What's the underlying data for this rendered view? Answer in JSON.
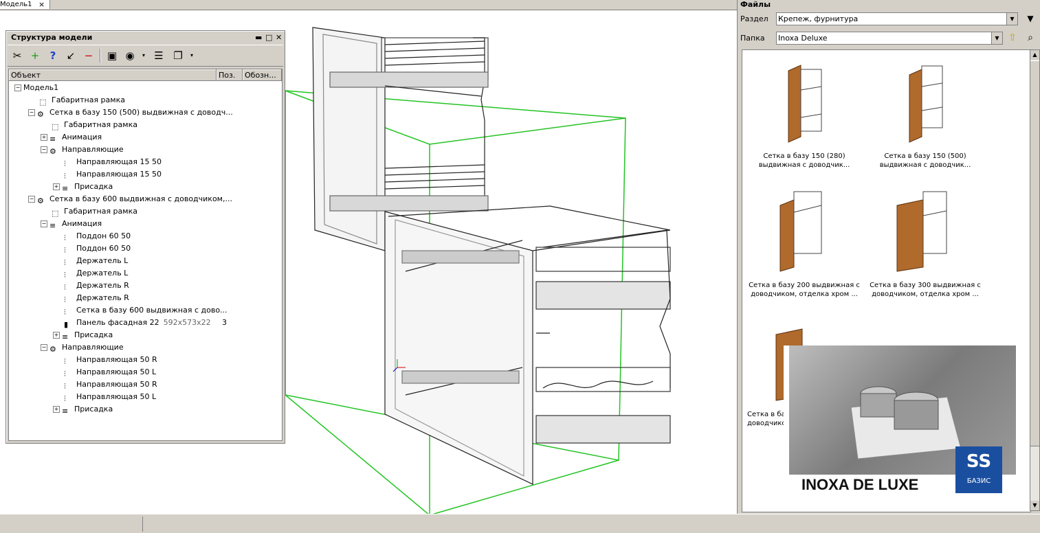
{
  "tab": {
    "label": "Модель1",
    "close": "×"
  },
  "model_panel": {
    "title": "Структура модели",
    "columns": {
      "object": "Объект",
      "pos": "Поз.",
      "code": "Обозн..."
    },
    "tree": [
      {
        "label": "Модель1",
        "pos": ""
      },
      {
        "label": "Габаритная рамка",
        "pos": ""
      },
      {
        "label": "Сетка в базу 150 (500) выдвижная с доводч...",
        "pos": ""
      },
      {
        "label": "Габаритная рамка",
        "pos": ""
      },
      {
        "label": "Анимация",
        "pos": ""
      },
      {
        "label": "Направляющие",
        "pos": ""
      },
      {
        "label": "Направляющая 15 50",
        "pos": ""
      },
      {
        "label": "Направляющая 15 50",
        "pos": ""
      },
      {
        "label": "Присадка",
        "pos": ""
      },
      {
        "label": "Сетка в базу 600 выдвижная с доводчиком,...",
        "pos": ""
      },
      {
        "label": "Габаритная рамка",
        "pos": ""
      },
      {
        "label": "Анимация",
        "pos": ""
      },
      {
        "label": "Поддон 60 50",
        "pos": ""
      },
      {
        "label": "Поддон 60 50",
        "pos": ""
      },
      {
        "label": "Держатель L",
        "pos": ""
      },
      {
        "label": "Держатель L",
        "pos": ""
      },
      {
        "label": "Держатель R",
        "pos": ""
      },
      {
        "label": "Держатель R",
        "pos": ""
      },
      {
        "label": "Сетка в базу 600 выдвижная с дово...",
        "pos": ""
      },
      {
        "label": "Панель фасадная 22",
        "dims": "592x573x22",
        "pos": "3"
      },
      {
        "label": "Присадка",
        "pos": ""
      },
      {
        "label": "Направляющие",
        "pos": ""
      },
      {
        "label": "Направляющая 50 R",
        "pos": ""
      },
      {
        "label": "Направляющая 50 L",
        "pos": ""
      },
      {
        "label": "Направляющая 50 R",
        "pos": ""
      },
      {
        "label": "Направляющая 50 L",
        "pos": ""
      },
      {
        "label": "Присадка",
        "pos": ""
      }
    ]
  },
  "files_panel": {
    "title": "Файлы",
    "section_label": "Раздел",
    "section_value": "Крепеж, фурнитура",
    "folder_label": "Папка",
    "folder_value": "Inoxa Deluxe",
    "items": [
      {
        "line1": "Сетка в базу 150 (280)",
        "line2": "выдвижная с доводчик..."
      },
      {
        "line1": "Сетка в базу 150 (500)",
        "line2": "выдвижная с доводчик..."
      },
      {
        "line1": "Сетка в базу 200 выдвижная с",
        "line2": "доводчиком, отделка хром ..."
      },
      {
        "line1": "Сетка в базу 300 выдвижная с",
        "line2": "доводчиком, отделка хром ..."
      },
      {
        "line1": "Сетка в ба",
        "line2": "доводчико"
      }
    ],
    "preview": {
      "brand": "INOXA DE LUXE",
      "logo_text": "БАЗИС"
    }
  }
}
